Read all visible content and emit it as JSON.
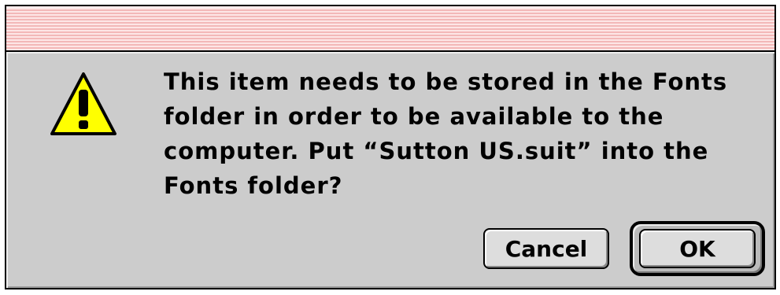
{
  "dialog": {
    "icon": "warning-triangle-icon",
    "message": "This item needs to be stored in the Fonts\nfolder in order to be available to the\ncomputer. Put “Sutton US.suit” into the\nFonts folder?",
    "buttons": {
      "cancel_label": "Cancel",
      "ok_label": "OK"
    }
  },
  "colors": {
    "title_bar_stripe": "#f3b8b8",
    "dialog_background": "#cccccc",
    "warning_fill": "#ffff00"
  }
}
